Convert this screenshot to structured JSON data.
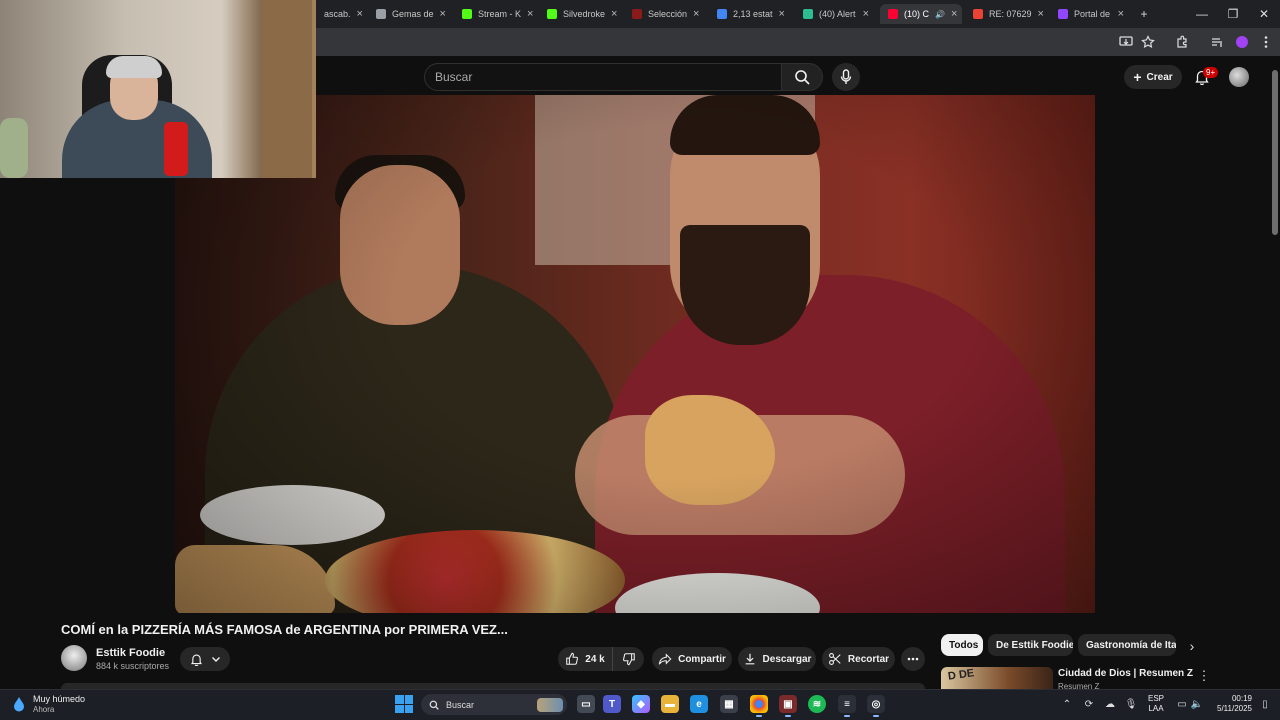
{
  "browser": {
    "tabs": [
      {
        "label": "ascab.",
        "fav": "#e6e6e6"
      },
      {
        "label": "Gemas de",
        "fav": "#9aa0a6"
      },
      {
        "label": "Stream - K",
        "fav": "#53fc18"
      },
      {
        "label": "Silvedroke",
        "fav": "#53fc18"
      },
      {
        "label": "Selección",
        "fav": "#8b1a1a"
      },
      {
        "label": "2,13 estat",
        "fav": "#4285f4"
      },
      {
        "label": "(40) Alert",
        "fav": "#2dbd8f"
      },
      {
        "label": "(10) C",
        "fav": "#ff0033"
      },
      {
        "label": "RE: 07629",
        "fav": "#ea4335"
      },
      {
        "label": "Portal de",
        "fav": "#9146ff"
      }
    ],
    "new_tab": "+",
    "minimize": "—",
    "restore": "❐",
    "close": "✕"
  },
  "youtube": {
    "search_placeholder": "Buscar",
    "create_label": "Crear",
    "notif_count": "9+",
    "video_title": "COMÍ en la PIZZERÍA MÁS FAMOSA de ARGENTINA por PRIMERA VEZ...",
    "channel_name": "Esttik Foodie",
    "subscribers": "884 k suscriptores",
    "likes": "24 k",
    "share": "Compartir",
    "download": "Descargar",
    "clip": "Recortar",
    "chips": [
      "Todos",
      "De Esttik Foodie",
      "Gastronomía de Italia"
    ],
    "rec_title": "Ciudad de Dios | Resumen Z",
    "rec_channel": "Resumen Z",
    "rec_thumb_text": "D DE"
  },
  "taskbar": {
    "weather_main": "Muy húmedo",
    "weather_sub": "Ahora",
    "search": "Buscar",
    "lang_top": "ESP",
    "lang_bottom": "LAA",
    "time": "00:19",
    "date": "5/11/2025"
  }
}
